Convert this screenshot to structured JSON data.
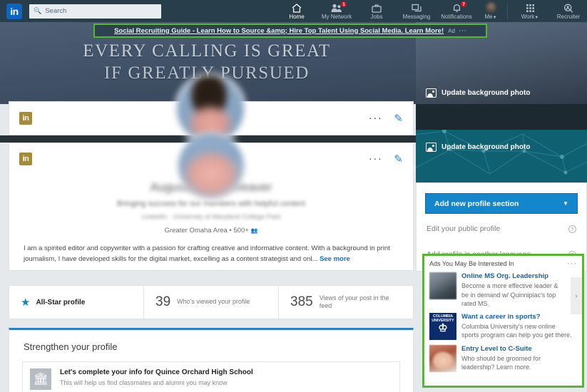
{
  "nav": {
    "logo": "in",
    "search_placeholder": "Search",
    "search_icon": "search-icon",
    "items": [
      {
        "label": "Home",
        "icon": "home-icon",
        "badge": ""
      },
      {
        "label": "My Network",
        "icon": "people-icon",
        "badge": "1"
      },
      {
        "label": "Jobs",
        "icon": "briefcase-icon",
        "badge": ""
      },
      {
        "label": "Messaging",
        "icon": "message-icon",
        "badge": ""
      },
      {
        "label": "Notifications",
        "icon": "bell-icon",
        "badge": "7"
      }
    ],
    "me_label": "Me",
    "work_label": "Work",
    "recruiter_label": "Recruiter"
  },
  "ad_banner": {
    "text": "Social Recruiting Guide - Learn How to Source &amp; Hire Top Talent Using Social Media. Learn More!",
    "tag": "Ad",
    "dots": "···"
  },
  "cover": {
    "line1": "EVERY CALLING IS GREAT",
    "line2": "IF GREATLY PURSUED"
  },
  "profile": {
    "card_logo": "in",
    "name": "Augusta Chen Weaver",
    "headline": "Bringing success for our members with helpful content",
    "subline": "LinkedIn · University of Maryland College Park",
    "location": "Greater Omaha Area",
    "connections": "500+",
    "about": "I am a spirited editor and copywriter with a passion for crafting creative and informative content. With a background in print journalism, I have developed skills for the digital market, excelling as a content strategist and onl...",
    "see_more": "See more",
    "more_dots": "···",
    "edit_icon": "pencil-icon"
  },
  "stats": [
    {
      "icon": "star-icon",
      "strong": "All-Star profile",
      "number": "",
      "label": ""
    },
    {
      "icon": "",
      "strong": "",
      "number": "39",
      "label": "Who's viewed your profile"
    },
    {
      "icon": "",
      "strong": "",
      "number": "385",
      "label": "Views of your post in the feed"
    }
  ],
  "strengthen": {
    "title": "Strengthen your profile",
    "item_icon": "school-icon",
    "item_title": "Let's complete your info for Quince Orchard High School",
    "item_sub": "This will help us find classmates and alumni you may know"
  },
  "rail": {
    "update_bg_1": "Update background photo",
    "update_bg_2": "Update background photo",
    "add_section": "Add new profile section",
    "caret": "▼",
    "links": [
      {
        "label": "Edit your public profile",
        "help": "?"
      },
      {
        "label": "Add profile in another language",
        "help": "?"
      }
    ]
  },
  "ads": {
    "title": "Ads You May Be Interested In",
    "dots": "···",
    "next": "›",
    "items": [
      {
        "thumb": "group-photo-thumb",
        "headline": "Online MS Org. Leadership",
        "body": "Become a more effective leader & be in demand w/ Quinnipiac's top rated MS."
      },
      {
        "thumb": "columbia-university-logo",
        "logo_line1": "COLUMBIA",
        "logo_line2": "UNIVERSITY",
        "headline": "Want a career in sports?",
        "body": "Columbia University's new online sports program can help you get there."
      },
      {
        "thumb": "person-photo-thumb",
        "headline": "Entry Level to C-Suite",
        "body": "Who should be groomed for leadership? Learn more."
      }
    ]
  },
  "colors": {
    "nav_bg": "#283e4a",
    "linkedin_blue": "#0a66c2",
    "accent_green": "#56b82c",
    "badge_red": "#d11124",
    "button_blue": "#1486cc",
    "teal": "#0f6070",
    "gold": "#a68a36"
  }
}
